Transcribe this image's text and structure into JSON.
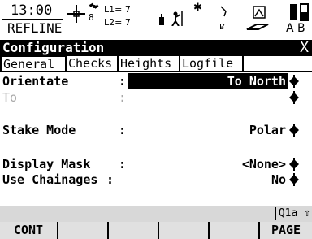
{
  "status": {
    "time": "13:00",
    "mode": "REFLINE",
    "sat_count": "8",
    "l1": "L1= 7",
    "l2": "L2= 7",
    "battery_labels": "A B",
    "icons": [
      "crosshair-icon",
      "satellite-icon",
      "pole-icon",
      "bluetooth-icon",
      "radio-icon",
      "memory-icon",
      "battery-icon"
    ]
  },
  "title": {
    "text": "Configuration",
    "close": "X"
  },
  "tabs": [
    {
      "label": "General",
      "active": true
    },
    {
      "label": "Checks",
      "active": false
    },
    {
      "label": "Heights",
      "active": false
    },
    {
      "label": "Logfile",
      "active": false
    }
  ],
  "form": {
    "orientate": {
      "label": "Orientate",
      "value": "To North"
    },
    "to": {
      "label": "To",
      "value": ""
    },
    "stake_mode": {
      "label": "Stake Mode",
      "value": "Polar"
    },
    "display_mask": {
      "label": "Display Mask",
      "value": "<None>"
    },
    "use_chainages": {
      "label": "Use Chainages",
      "value": "No"
    }
  },
  "footer": {
    "page_indicator": "Q1a ⇧",
    "keys": [
      "CONT",
      "",
      "",
      "",
      "",
      "PAGE"
    ]
  }
}
